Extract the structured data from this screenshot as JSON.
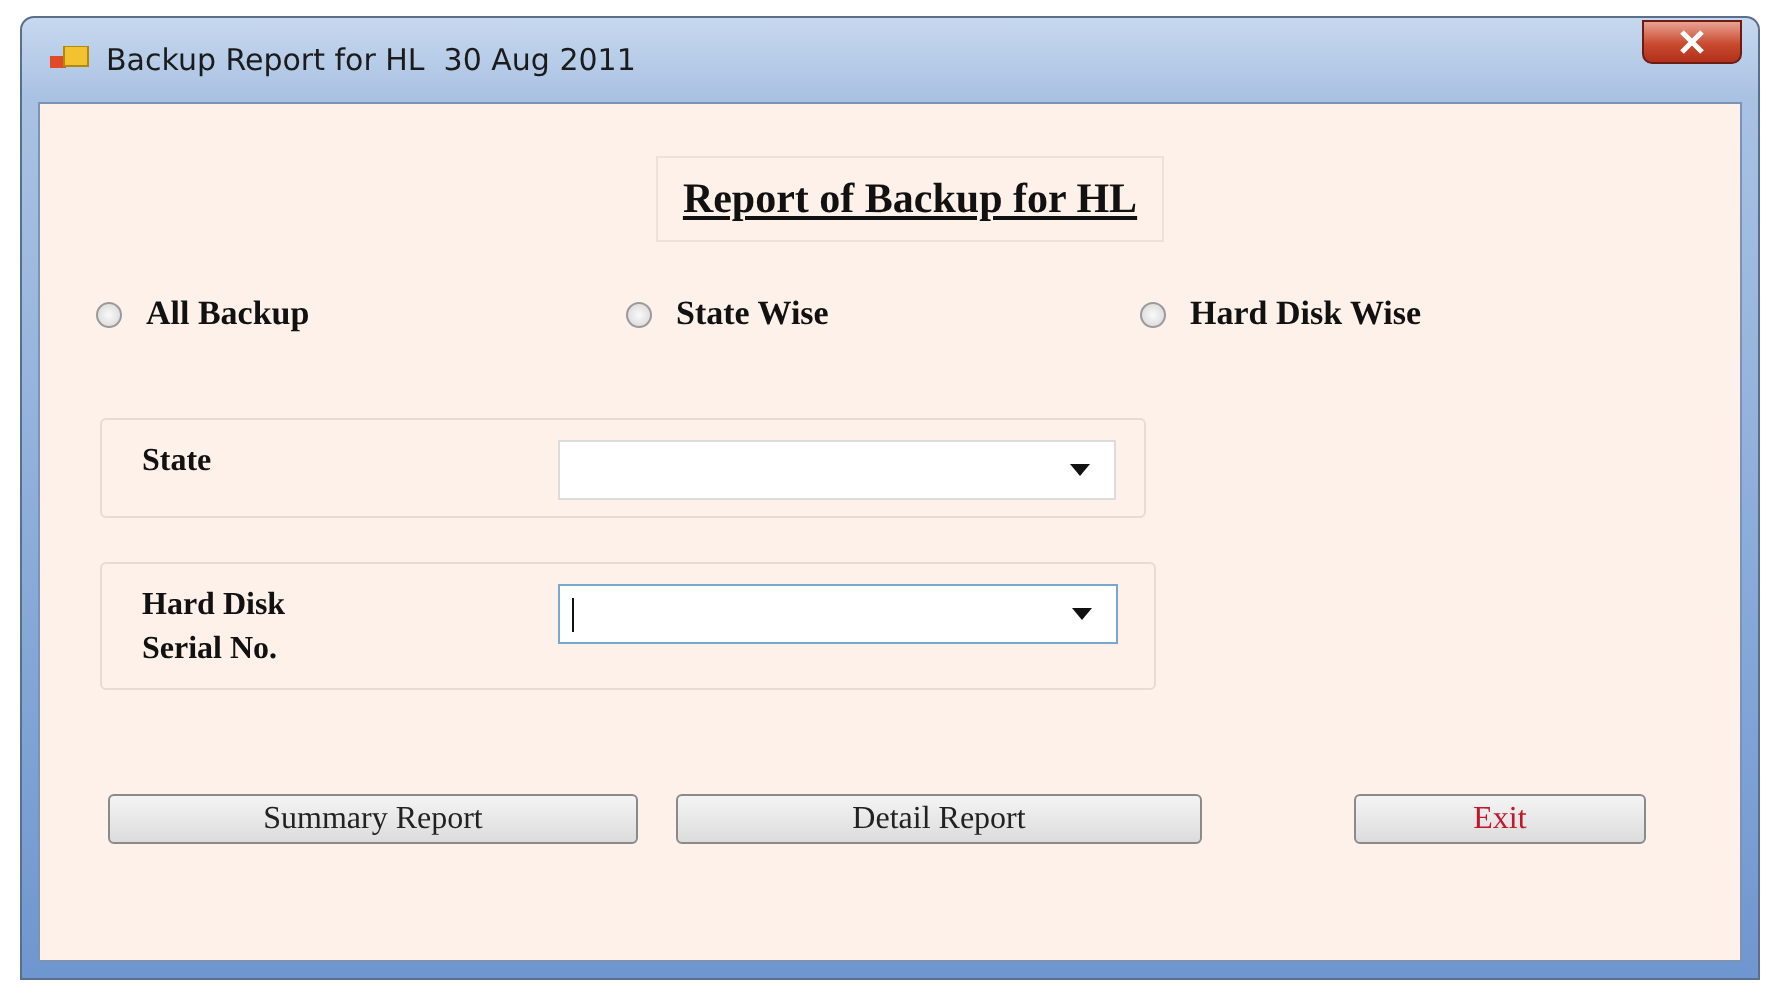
{
  "window": {
    "title": "Backup Report for HL  30 Aug 2011"
  },
  "heading": "Report of Backup for HL",
  "radios": [
    {
      "label": "All Backup",
      "selected": false
    },
    {
      "label": "State Wise",
      "selected": false
    },
    {
      "label": "Hard Disk Wise",
      "selected": false
    }
  ],
  "groups": [
    {
      "label": "State",
      "focused": false
    },
    {
      "label": "Hard Disk\nSerial No.",
      "focused": true
    }
  ],
  "buttons": [
    {
      "label": "Summary Report",
      "kind": "normal"
    },
    {
      "label": "Detail Report",
      "kind": "normal"
    },
    {
      "label": "Exit",
      "kind": "danger"
    }
  ]
}
